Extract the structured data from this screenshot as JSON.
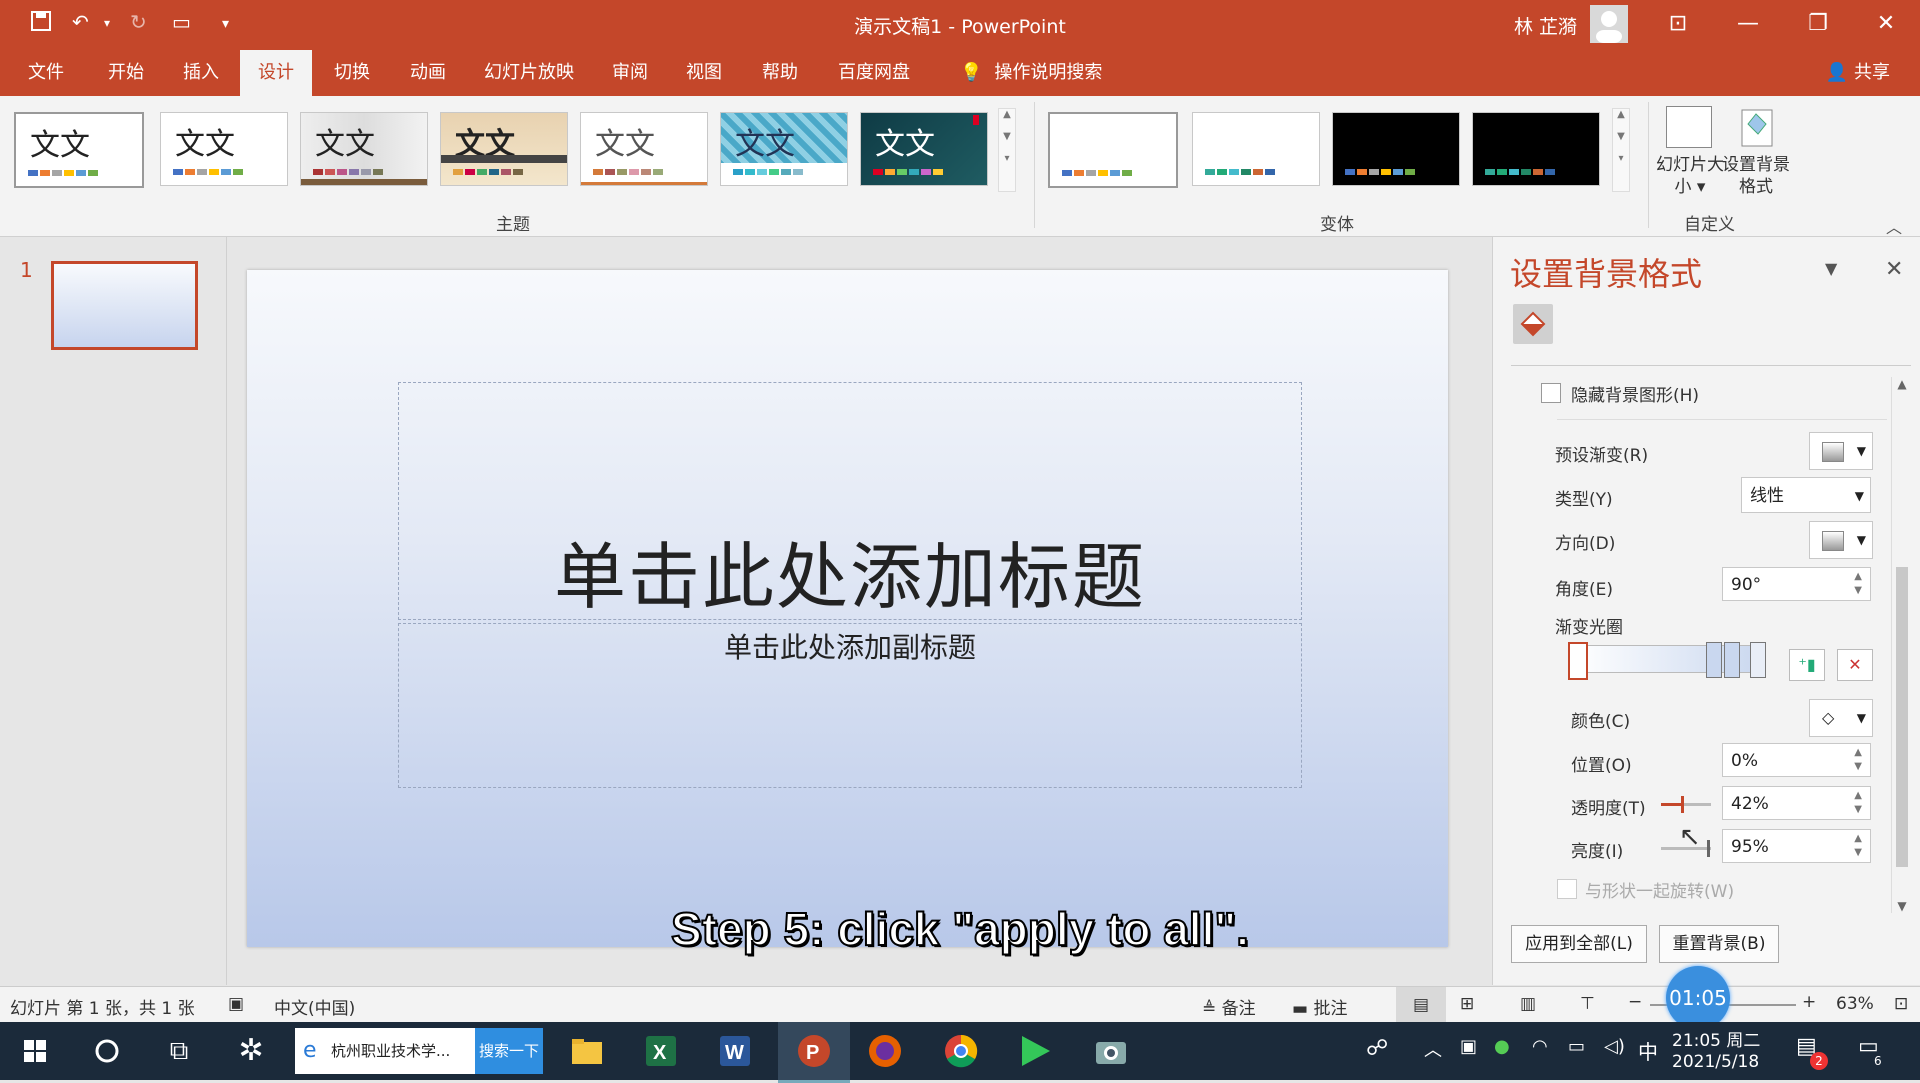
{
  "window": {
    "title": "演示文稿1 - PowerPoint",
    "user": "林 芷漪"
  },
  "tabs": [
    "文件",
    "开始",
    "插入",
    "设计",
    "切换",
    "动画",
    "幻灯片放映",
    "审阅",
    "视图",
    "帮助",
    "百度网盘",
    "操作说明搜索"
  ],
  "active_tab": "设计",
  "share_label": "共享",
  "ribbon": {
    "theme_glyph": "文文",
    "themes_group_label": "主题",
    "variants_group_label": "变体",
    "custom_group_label": "自定义",
    "slide_size_label": "幻灯片大小",
    "format_bg_label": "设置背景格式"
  },
  "slide_pane": {
    "slide_number": "1"
  },
  "slide": {
    "title_placeholder": "单击此处添加标题",
    "subtitle_placeholder": "单击此处添加副标题"
  },
  "caption": "Step 5: click \"apply to all\".",
  "format_pane": {
    "title": "设置背景格式",
    "hide_bg_graphics": "隐藏背景图形(H)",
    "preset_gradient_label": "预设渐变(R)",
    "type_label": "类型(Y)",
    "type_value": "线性",
    "direction_label": "方向(D)",
    "angle_label": "角度(E)",
    "angle_value": "90°",
    "gradient_stops_label": "渐变光圈",
    "color_label": "颜色(C)",
    "position_label": "位置(O)",
    "position_value": "0%",
    "transparency_label": "透明度(T)",
    "transparency_value": "42%",
    "brightness_label": "亮度(I)",
    "brightness_value": "95%",
    "rotate_with_shape": "与形状一起旋转(W)",
    "apply_all_button": "应用到全部(L)",
    "reset_bg_button": "重置背景(B)"
  },
  "status": {
    "slide_info": "幻灯片 第 1 张，共 1 张",
    "language": "中文(中国)",
    "notes": "备注",
    "comments": "批注",
    "zoom": "63%",
    "timer": "01:05"
  },
  "taskbar": {
    "browser_tab": "杭州职业技术学...",
    "search_button": "搜索一下",
    "time": "21:05 周二",
    "date": "2021/5/18",
    "ime": "中",
    "notification_count": "2",
    "notification_count2": "6"
  },
  "colors": {
    "accent": "#c4472a",
    "pane_title": "#c4472a"
  }
}
